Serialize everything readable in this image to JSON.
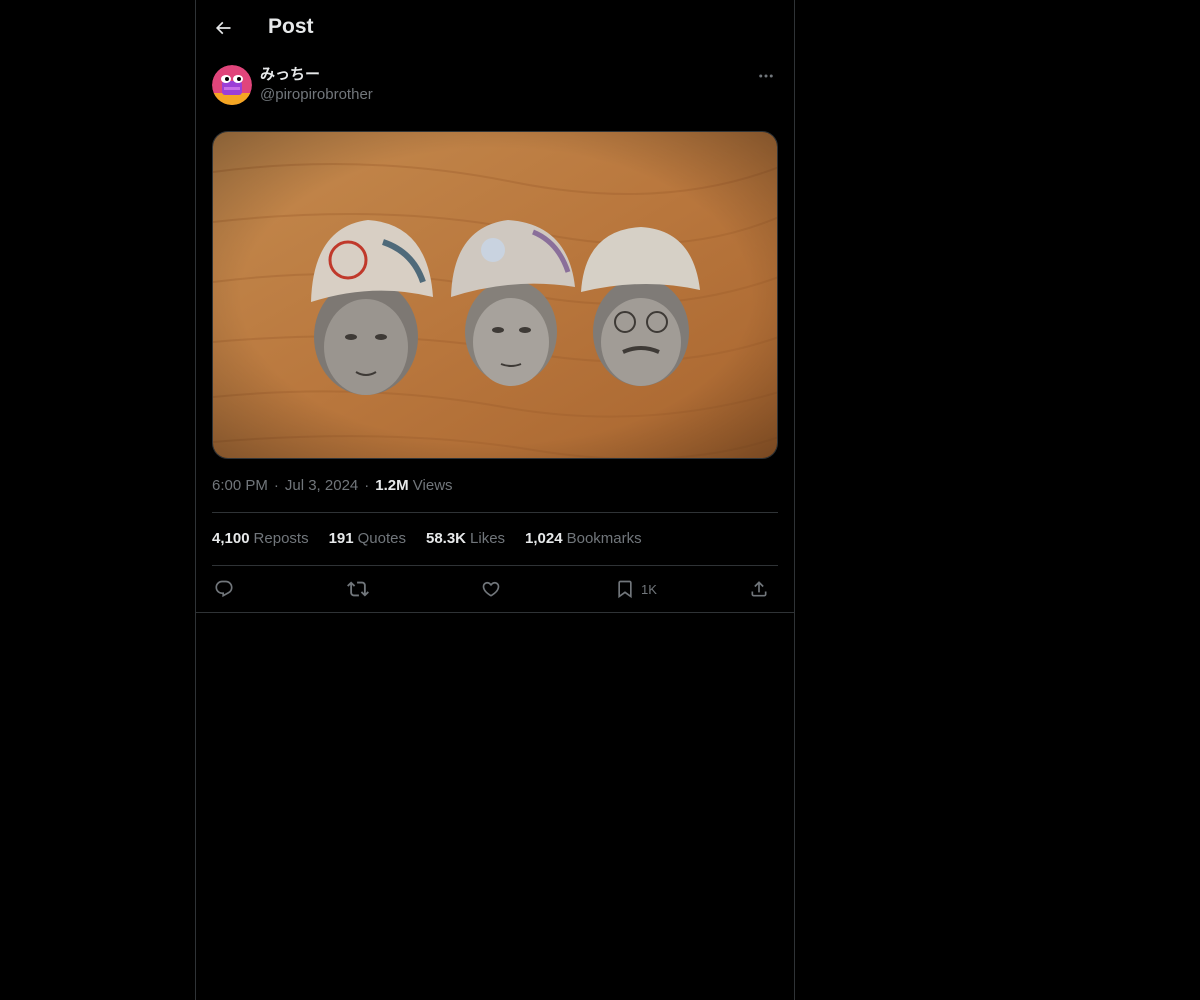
{
  "header": {
    "title": "Post",
    "back_icon": "arrow-left-icon"
  },
  "author": {
    "display_name": "みっちー",
    "handle": "@piropirobrother",
    "avatar_colors": [
      "#e0457b",
      "#9b3fd6",
      "#f5a623"
    ]
  },
  "post": {
    "media_description_colors": {
      "table": "#b9773d",
      "notes": "#8d8a86"
    },
    "time": "6:00 PM",
    "date": "Jul 3, 2024",
    "views_count": "1.2M",
    "views_label": "Views"
  },
  "stats": [
    {
      "num": "4,100",
      "label": "Reposts"
    },
    {
      "num": "191",
      "label": "Quotes"
    },
    {
      "num": "58.3K",
      "label": "Likes"
    },
    {
      "num": "1,024",
      "label": "Bookmarks"
    }
  ],
  "actions": {
    "reply_icon": "reply-icon",
    "repost_icon": "repost-icon",
    "like_icon": "heart-icon",
    "bookmark_icon": "bookmark-icon",
    "bookmark_count": "1K",
    "share_icon": "share-icon"
  },
  "colors": {
    "background": "#000000",
    "text_primary": "#e7e9ea",
    "text_secondary": "#71767b",
    "border": "#2f3336"
  }
}
